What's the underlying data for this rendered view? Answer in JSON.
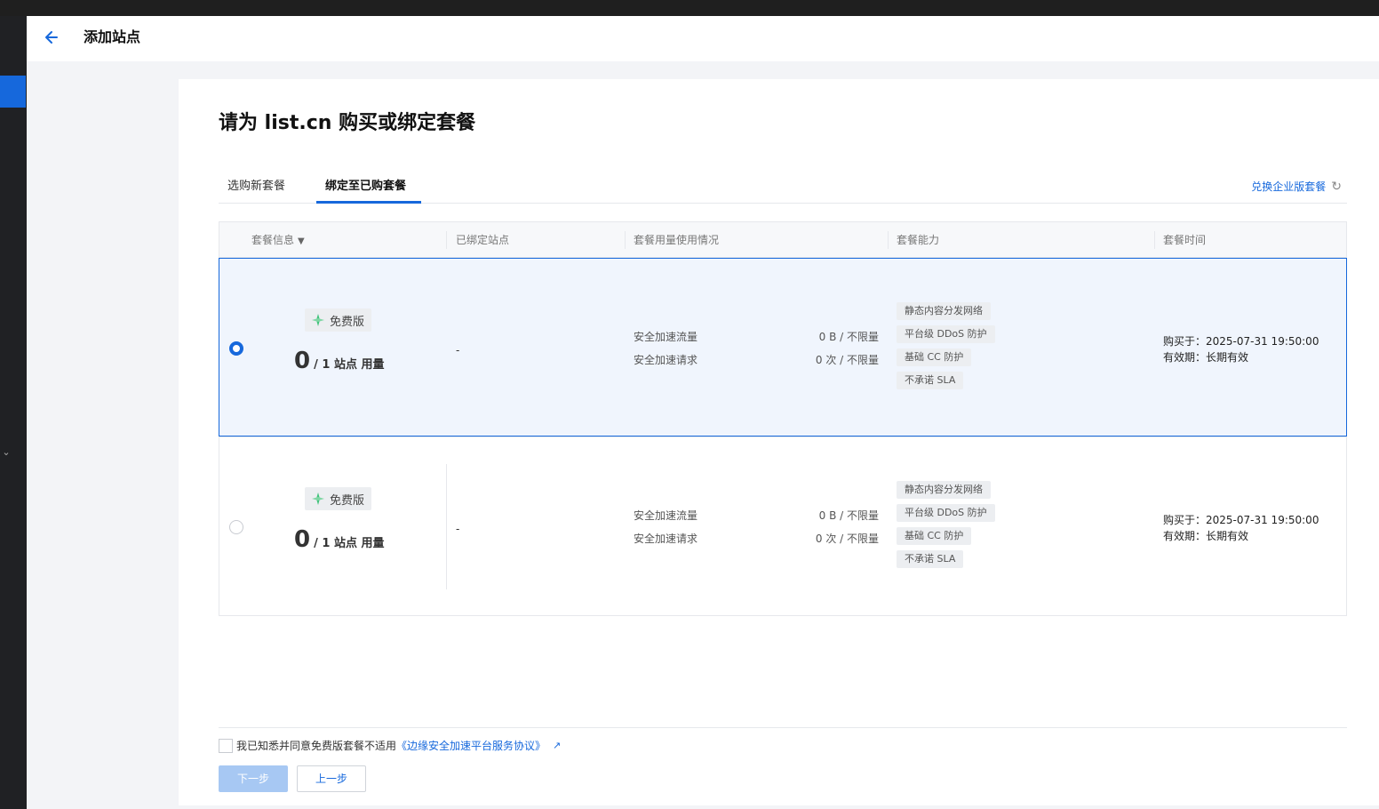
{
  "header": {
    "title": "添加站点"
  },
  "page": {
    "heading": "请为 list.cn 购买或绑定套餐"
  },
  "tabs": [
    {
      "label": "选购新套餐",
      "active": false
    },
    {
      "label": "绑定至已购套餐",
      "active": true
    }
  ],
  "exchange_link": "兑换企业版套餐",
  "table": {
    "columns": [
      "套餐信息",
      "已绑定站点",
      "套餐用量使用情况",
      "套餐能力",
      "套餐时间"
    ],
    "rows": [
      {
        "selected": true,
        "plan_name": "免费版",
        "usage_count": "0",
        "usage_suffix": "/ 1 站点 用量",
        "bound_site": "-",
        "traffic_label": "安全加速流量",
        "traffic_value": "0 B / 不限量",
        "requests_label": "安全加速请求",
        "requests_value": "0 次 / 不限量",
        "caps": [
          "静态内容分发网络",
          "平台级 DDoS 防护",
          "基础 CC 防护",
          "不承诺 SLA"
        ],
        "purchased": "购买于：2025-07-31 19:50:00",
        "validity": "有效期：长期有效"
      },
      {
        "selected": false,
        "plan_name": "免费版",
        "usage_count": "0",
        "usage_suffix": "/ 1 站点 用量",
        "bound_site": "-",
        "traffic_label": "安全加速流量",
        "traffic_value": "0 B / 不限量",
        "requests_label": "安全加速请求",
        "requests_value": "0 次 / 不限量",
        "caps": [
          "静态内容分发网络",
          "平台级 DDoS 防护",
          "基础 CC 防护",
          "不承诺 SLA"
        ],
        "purchased": "购买于：2025-07-31 19:50:00",
        "validity": "有效期：长期有效"
      }
    ]
  },
  "agreement": {
    "text": "我已知悉并同意免费版套餐不适用",
    "link": "《边缘安全加速平台服务协议》"
  },
  "buttons": {
    "next": "下一步",
    "prev": "上一步"
  },
  "colors": {
    "accent": "#1668dc",
    "selected_row_bg": "#f0f5fd"
  }
}
